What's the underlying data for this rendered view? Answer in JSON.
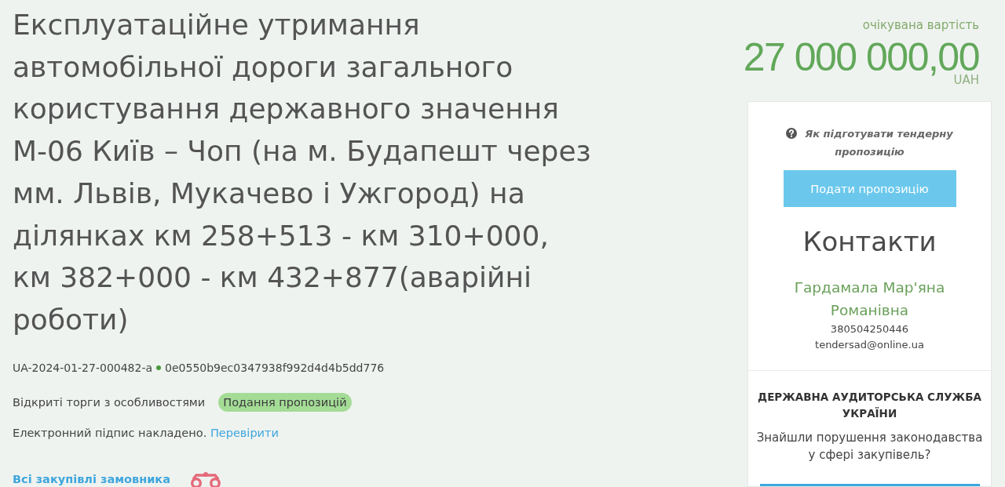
{
  "tender": {
    "title": "Експлуатаційне утримання автомобільної дороги загального користування державного значення М-06 Київ – Чоп (на м. Будапешт через мм. Львів, Мукачево і Ужгород) на ділянках км 258+513 - км 310+000, км 382+000 - км 432+877(аварійні роботи)",
    "id": "UA-2024-01-27-000482-a",
    "hash": "0e0550b9ec0347938f992d4d4b5dd776",
    "procedure": "Відкриті торги з особливостями",
    "status_badge": "Подання пропозицій",
    "signature": {
      "text": "Електронний підпис накладено.",
      "link": "Перевірити"
    },
    "customer_link": "Всі закупівлі замовника"
  },
  "price": {
    "label": "очікувана вартість",
    "amount": "27 000 000,00",
    "currency": "UAH"
  },
  "sidebar": {
    "help_link": "Як підготувати тендерну пропозицію",
    "submit_button": "Подати пропозицію",
    "contacts": {
      "heading": "Контакти",
      "name": "Гардамала Мар'яна Романівна",
      "phone": "380504250446",
      "email": "tendersad@online.ua"
    },
    "audit": {
      "title": "ДЕРЖАВНА АУДИТОРСЬКА СЛУЖБА УКРАЇНИ",
      "question": "Знайшли порушення законодавства у сфері закупівель?"
    }
  }
}
